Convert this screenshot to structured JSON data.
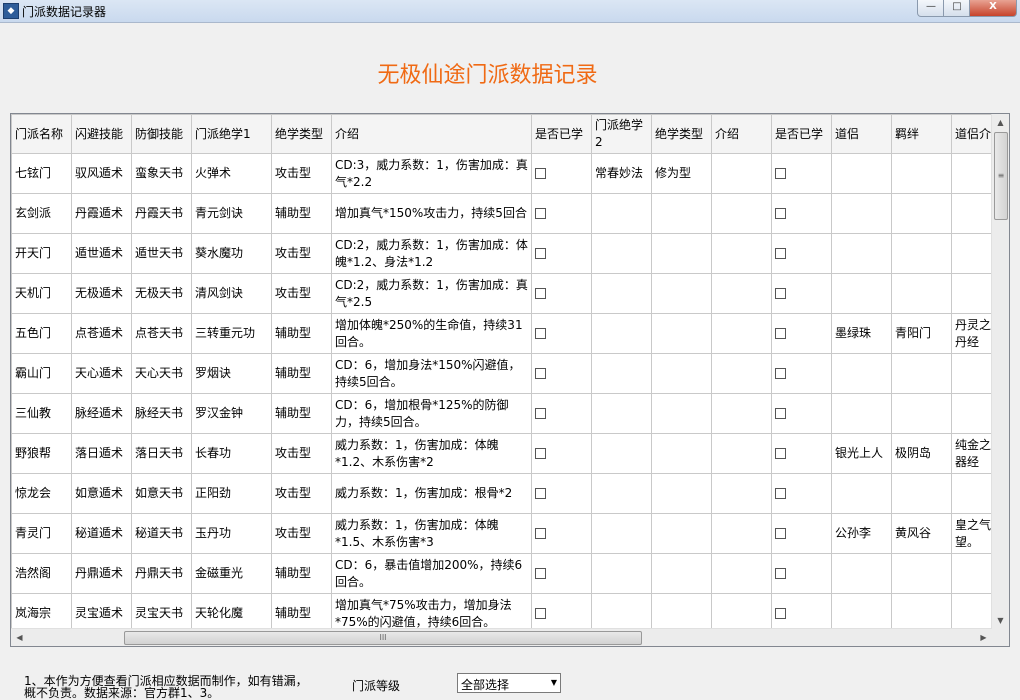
{
  "window": {
    "title": "门派数据记录器",
    "controls": {
      "minimize": "—",
      "maximize": "□",
      "close": "X"
    }
  },
  "heading": "无极仙途门派数据记录",
  "table": {
    "headers": [
      "门派名称",
      "闪避技能",
      "防御技能",
      "门派绝学1",
      "绝学类型",
      "介绍",
      "是否已学",
      "门派绝学2",
      "绝学类型",
      "介绍",
      "是否已学",
      "道侣",
      "羁绊",
      "道侣介"
    ],
    "rows": [
      {
        "sect": "七铉门",
        "dodge": "驭风遁术",
        "defense": "蛮象天书",
        "skill1": "火弹术",
        "type1": "攻击型",
        "intro1": "CD:3，威力系数：1，伤害加成：真气*2.2",
        "skill2": "常春妙法",
        "type2": "修为型",
        "intro2": "",
        "partner": "",
        "bond": "",
        "partner_intro": ""
      },
      {
        "sect": "玄剑派",
        "dodge": "丹霞遁术",
        "defense": "丹霞天书",
        "skill1": "青元剑诀",
        "type1": "辅助型",
        "intro1": "增加真气*150%攻击力，持续5回合",
        "skill2": "",
        "type2": "",
        "intro2": "",
        "partner": "",
        "bond": "",
        "partner_intro": ""
      },
      {
        "sect": "开天门",
        "dodge": "遁世遁术",
        "defense": "遁世天书",
        "skill1": "葵水魔功",
        "type1": "攻击型",
        "intro1": "CD:2，威力系数：1，伤害加成：体魄*1.2、身法*1.2",
        "skill2": "",
        "type2": "",
        "intro2": "",
        "partner": "",
        "bond": "",
        "partner_intro": ""
      },
      {
        "sect": "天机门",
        "dodge": "无极遁术",
        "defense": "无极天书",
        "skill1": "清风剑诀",
        "type1": "攻击型",
        "intro1": "CD:2，威力系数：1，伤害加成：真气*2.5",
        "skill2": "",
        "type2": "",
        "intro2": "",
        "partner": "",
        "bond": "",
        "partner_intro": ""
      },
      {
        "sect": "五色门",
        "dodge": "点苍遁术",
        "defense": "点苍天书",
        "skill1": "三转重元功",
        "type1": "辅助型",
        "intro1": "增加体魄*250%的生命值，持续31回合。",
        "skill2": "",
        "type2": "",
        "intro2": "",
        "partner": "墨绿珠",
        "bond": "青阳门",
        "partner_intro": "丹灵之炼丹经"
      },
      {
        "sect": "霸山门",
        "dodge": "天心遁术",
        "defense": "天心天书",
        "skill1": "罗烟诀",
        "type1": "辅助型",
        "intro1": "CD：6，增加身法*150%闪避值，持续5回合。",
        "skill2": "",
        "type2": "",
        "intro2": "",
        "partner": "",
        "bond": "",
        "partner_intro": ""
      },
      {
        "sect": "三仙教",
        "dodge": "脉经遁术",
        "defense": "脉经天书",
        "skill1": "罗汉金钟",
        "type1": "辅助型",
        "intro1": "CD：6，增加根骨*125%的防御力，持续5回合。",
        "skill2": "",
        "type2": "",
        "intro2": "",
        "partner": "",
        "bond": "",
        "partner_intro": ""
      },
      {
        "sect": "野狼帮",
        "dodge": "落日遁术",
        "defense": "落日天书",
        "skill1": "长春功",
        "type1": "攻击型",
        "intro1": "威力系数：1，伤害加成：体魄*1.2、木系伤害*2",
        "skill2": "",
        "type2": "",
        "intro2": "",
        "partner": "银光上人",
        "bond": "极阴岛",
        "partner_intro": "纯金之炼器经"
      },
      {
        "sect": "惊龙会",
        "dodge": "如意遁术",
        "defense": "如意天书",
        "skill1": "正阳劲",
        "type1": "攻击型",
        "intro1": "威力系数：1，伤害加成：根骨*2",
        "skill2": "",
        "type2": "",
        "intro2": "",
        "partner": "",
        "bond": "",
        "partner_intro": ""
      },
      {
        "sect": "青灵门",
        "dodge": "秘道遁术",
        "defense": "秘道天书",
        "skill1": "玉丹功",
        "type1": "攻击型",
        "intro1": "威力系数：1，伤害加成：体魄*1.5、木系伤害*3",
        "skill2": "",
        "type2": "",
        "intro2": "",
        "partner": "公孙李",
        "bond": "黄风谷",
        "partner_intro": "皇之气望。"
      },
      {
        "sect": "浩然阁",
        "dodge": "丹鼎遁术",
        "defense": "丹鼎天书",
        "skill1": "金磁重光",
        "type1": "辅助型",
        "intro1": "CD：6，暴击值增加200%，持续6回合。",
        "skill2": "",
        "type2": "",
        "intro2": "",
        "partner": "",
        "bond": "",
        "partner_intro": ""
      },
      {
        "sect": "岚海宗",
        "dodge": "灵宝遁术",
        "defense": "灵宝天书",
        "skill1": "天轮化魔",
        "type1": "辅助型",
        "intro1": "增加真气*75%攻击力，增加身法*75%的闪避值，持续6回合。",
        "skill2": "",
        "type2": "",
        "intro2": "",
        "partner": "",
        "bond": "",
        "partner_intro": ""
      }
    ]
  },
  "scrollbar": {
    "up": "▲",
    "down": "▼",
    "left": "◀",
    "right": "▶",
    "grip_v": "≡",
    "grip_h": "III"
  },
  "footer": {
    "note": "1、本作为方便查看门派相应数据而制作，如有错漏，概不负责。数据来源：官方群1、3。",
    "level_label": "门派等级",
    "level_select": {
      "value": "全部选择",
      "arrow": "▼"
    }
  }
}
